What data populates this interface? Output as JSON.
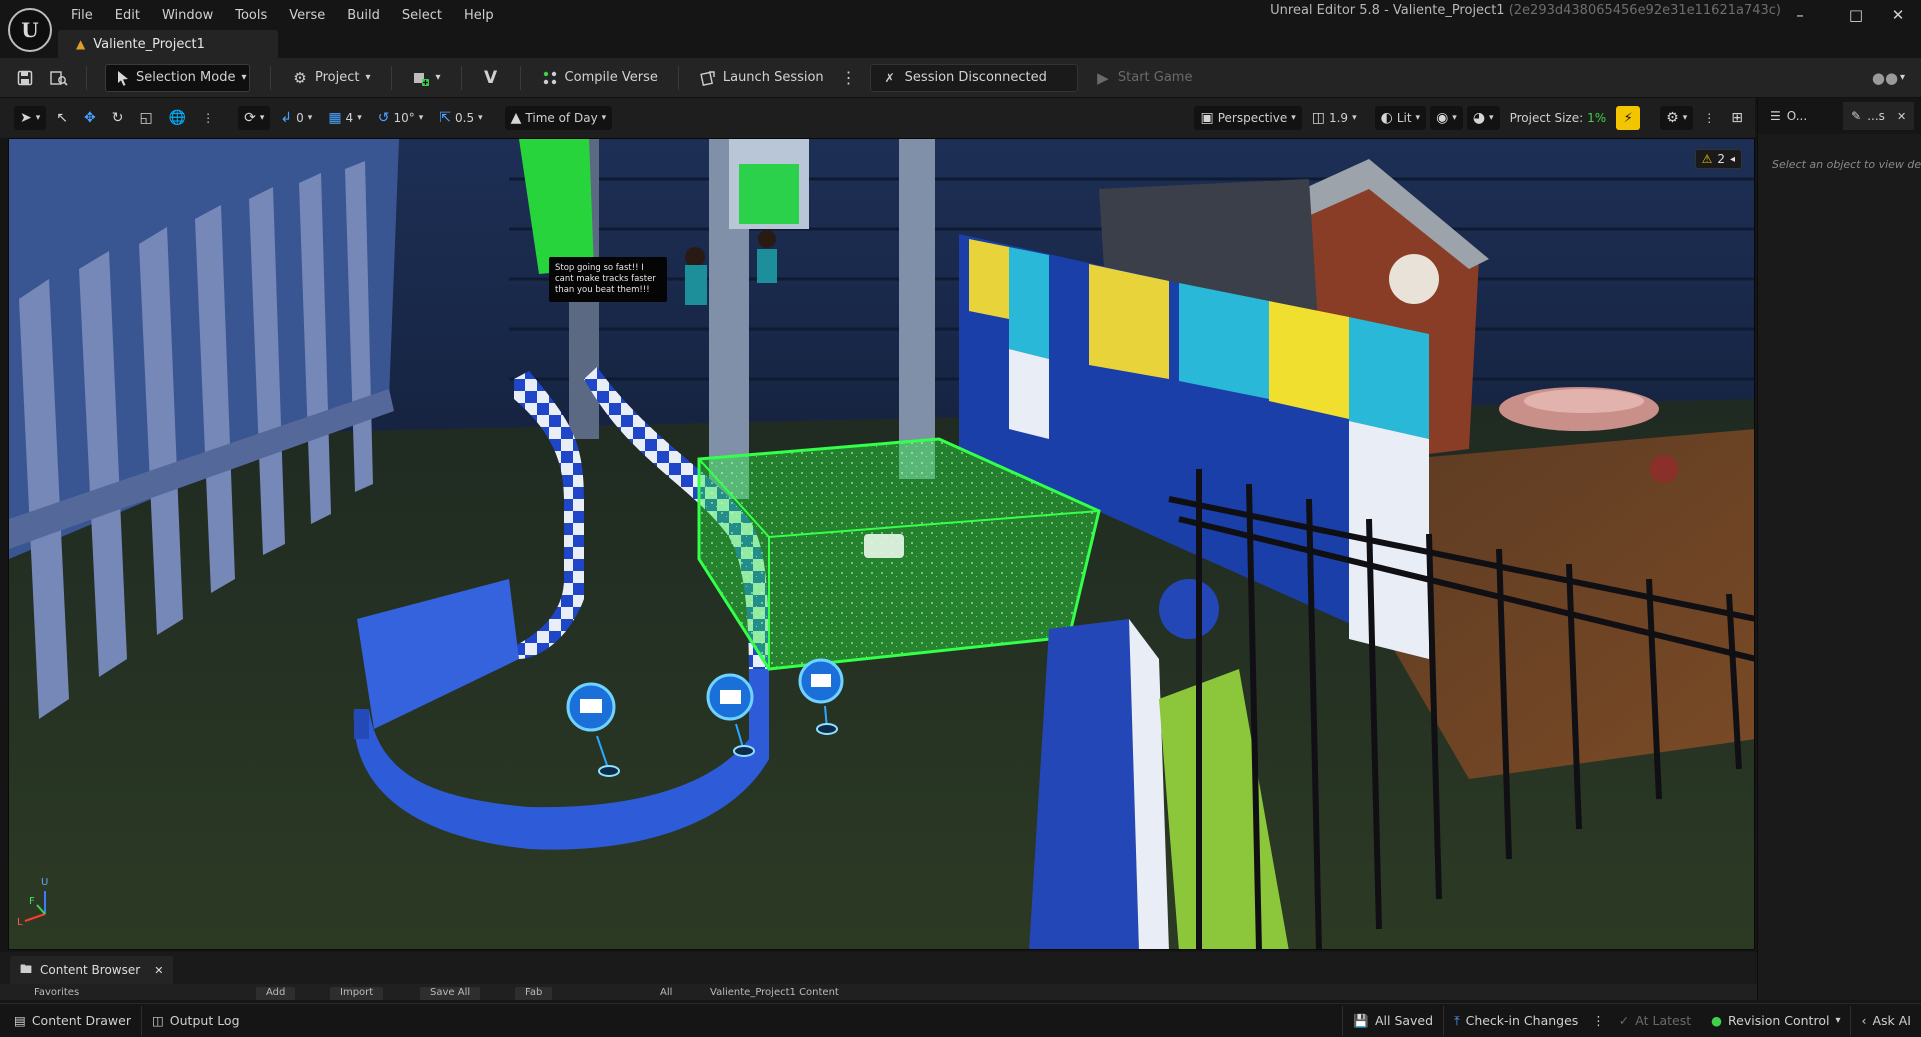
{
  "app": {
    "window_title": "Unreal Editor 5.8 - Valiente_Project1",
    "window_hash": "(2e293d438065456e92e31e11621a743c)",
    "project_tab": "Valiente_Project1"
  },
  "menu": [
    "File",
    "Edit",
    "Window",
    "Tools",
    "Verse",
    "Build",
    "Select",
    "Help"
  ],
  "toolbar": {
    "selection_mode": "Selection Mode",
    "project": "Project",
    "compile_verse": "Compile Verse",
    "launch_session": "Launch Session",
    "session_status": "Session Disconnected",
    "start_game": "Start Game"
  },
  "viewport_toolbar": {
    "rotation_snap": "0",
    "scale_snap": "4",
    "angle_snap": "10°",
    "grid_snap": "0.5",
    "time_of_day": "Time of Day",
    "perspective": "Perspective",
    "camera_speed": "1.9",
    "view_mode": "Lit",
    "project_size_label": "Project Size:",
    "project_size_value": "1%"
  },
  "viewport": {
    "warning_count": "2",
    "speech_bubble": "Stop going so fast!! I cant make tracks faster than you beat them!!!",
    "axis_x": "L",
    "axis_y": "U",
    "axis_z": "F"
  },
  "right_panel": {
    "tab_outliner": "O...",
    "tab_details": "...s",
    "hint": "Select an object to view det"
  },
  "content_browser": {
    "tab_label": "Content Browser",
    "favorites": "Favorites",
    "add": "Add",
    "import": "Import",
    "save_all": "Save All",
    "fab": "Fab",
    "path_all": "All",
    "path_content": "Valiente_Project1 Content"
  },
  "statusbar": {
    "content_drawer": "Content Drawer",
    "output_log": "Output Log",
    "all_saved": "All Saved",
    "check_in": "Check-in Changes",
    "at_latest": "At Latest",
    "revision_control": "Revision Control",
    "ask_ai": "Ask AI"
  },
  "colors": {
    "accent_green": "#3fd14a",
    "warning_yellow": "#f2c500",
    "ui_blue": "#4aa3ff"
  }
}
